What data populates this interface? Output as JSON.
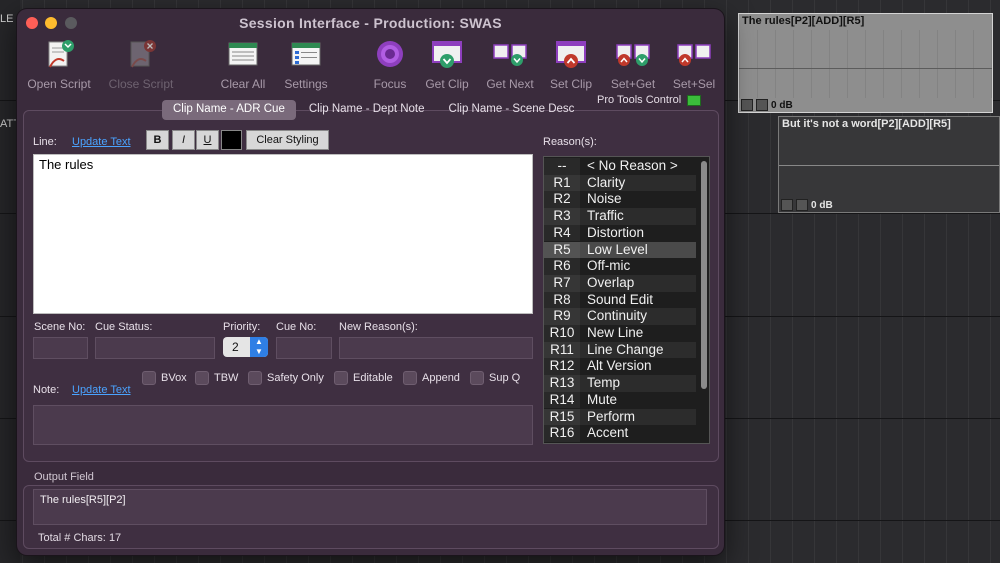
{
  "window": {
    "title": "Session Interface  -  Production:  SWAS"
  },
  "toolbar": {
    "open_script": "Open Script",
    "close_script": "Close Script",
    "clear_all": "Clear All",
    "settings": "Settings",
    "focus": "Focus",
    "get_clip": "Get Clip",
    "get_next": "Get Next",
    "set_clip": "Set Clip",
    "set_get": "Set+Get",
    "set_sel": "Set+Sel",
    "pro_tools_control": "Pro Tools Control"
  },
  "tabs": [
    "Clip Name - ADR Cue",
    "Clip Name - Dept Note",
    "Clip Name - Scene Desc"
  ],
  "line": {
    "label": "Line:",
    "update_text": "Update Text",
    "bold": "B",
    "italic": "I",
    "underline": "U",
    "clear_styling": "Clear Styling",
    "text": "The rules"
  },
  "fields": {
    "scene_no": "Scene No:",
    "cue_status": "Cue Status:",
    "priority": "Priority:",
    "priority_value": "2",
    "cue_no": "Cue No:",
    "new_reasons": "New Reason(s):"
  },
  "checkboxes": [
    "BVox",
    "TBW",
    "Safety Only",
    "Editable",
    "Append",
    "Sup Q"
  ],
  "note": {
    "label": "Note:",
    "update_text": "Update Text"
  },
  "reasons": {
    "label": "Reason(s):",
    "items": [
      {
        "code": "--",
        "name": "< No Reason >"
      },
      {
        "code": "R1",
        "name": "Clarity"
      },
      {
        "code": "R2",
        "name": "Noise"
      },
      {
        "code": "R3",
        "name": "Traffic"
      },
      {
        "code": "R4",
        "name": "Distortion"
      },
      {
        "code": "R5",
        "name": "Low Level"
      },
      {
        "code": "R6",
        "name": "Off-mic"
      },
      {
        "code": "R7",
        "name": "Overlap"
      },
      {
        "code": "R8",
        "name": "Sound Edit"
      },
      {
        "code": "R9",
        "name": "Continuity"
      },
      {
        "code": "R10",
        "name": "New Line"
      },
      {
        "code": "R11",
        "name": "Line Change"
      },
      {
        "code": "R12",
        "name": "Alt Version"
      },
      {
        "code": "R13",
        "name": "Temp"
      },
      {
        "code": "R14",
        "name": "Mute"
      },
      {
        "code": "R15",
        "name": "Perform"
      },
      {
        "code": "R16",
        "name": "Accent"
      }
    ],
    "selected_code": "R5"
  },
  "output": {
    "label": "Output Field",
    "value": "The rules[R5][P2]",
    "chars_label": "Total # Chars:",
    "chars_value": "17"
  },
  "background": {
    "left_labels": [
      "LE",
      "ATT"
    ],
    "clip1_title": "The rules[P2][ADD][R5]",
    "clip1_gain": "0 dB",
    "clip2_title": "But it's not a word[P2][ADD][R5]",
    "clip2_gain": "0 dB"
  },
  "colors": {
    "window_bg": "#3a2b3c",
    "link": "#4aa3ff",
    "selected_row": "#4a4a4a",
    "pt_led": "#3bbd3b"
  }
}
